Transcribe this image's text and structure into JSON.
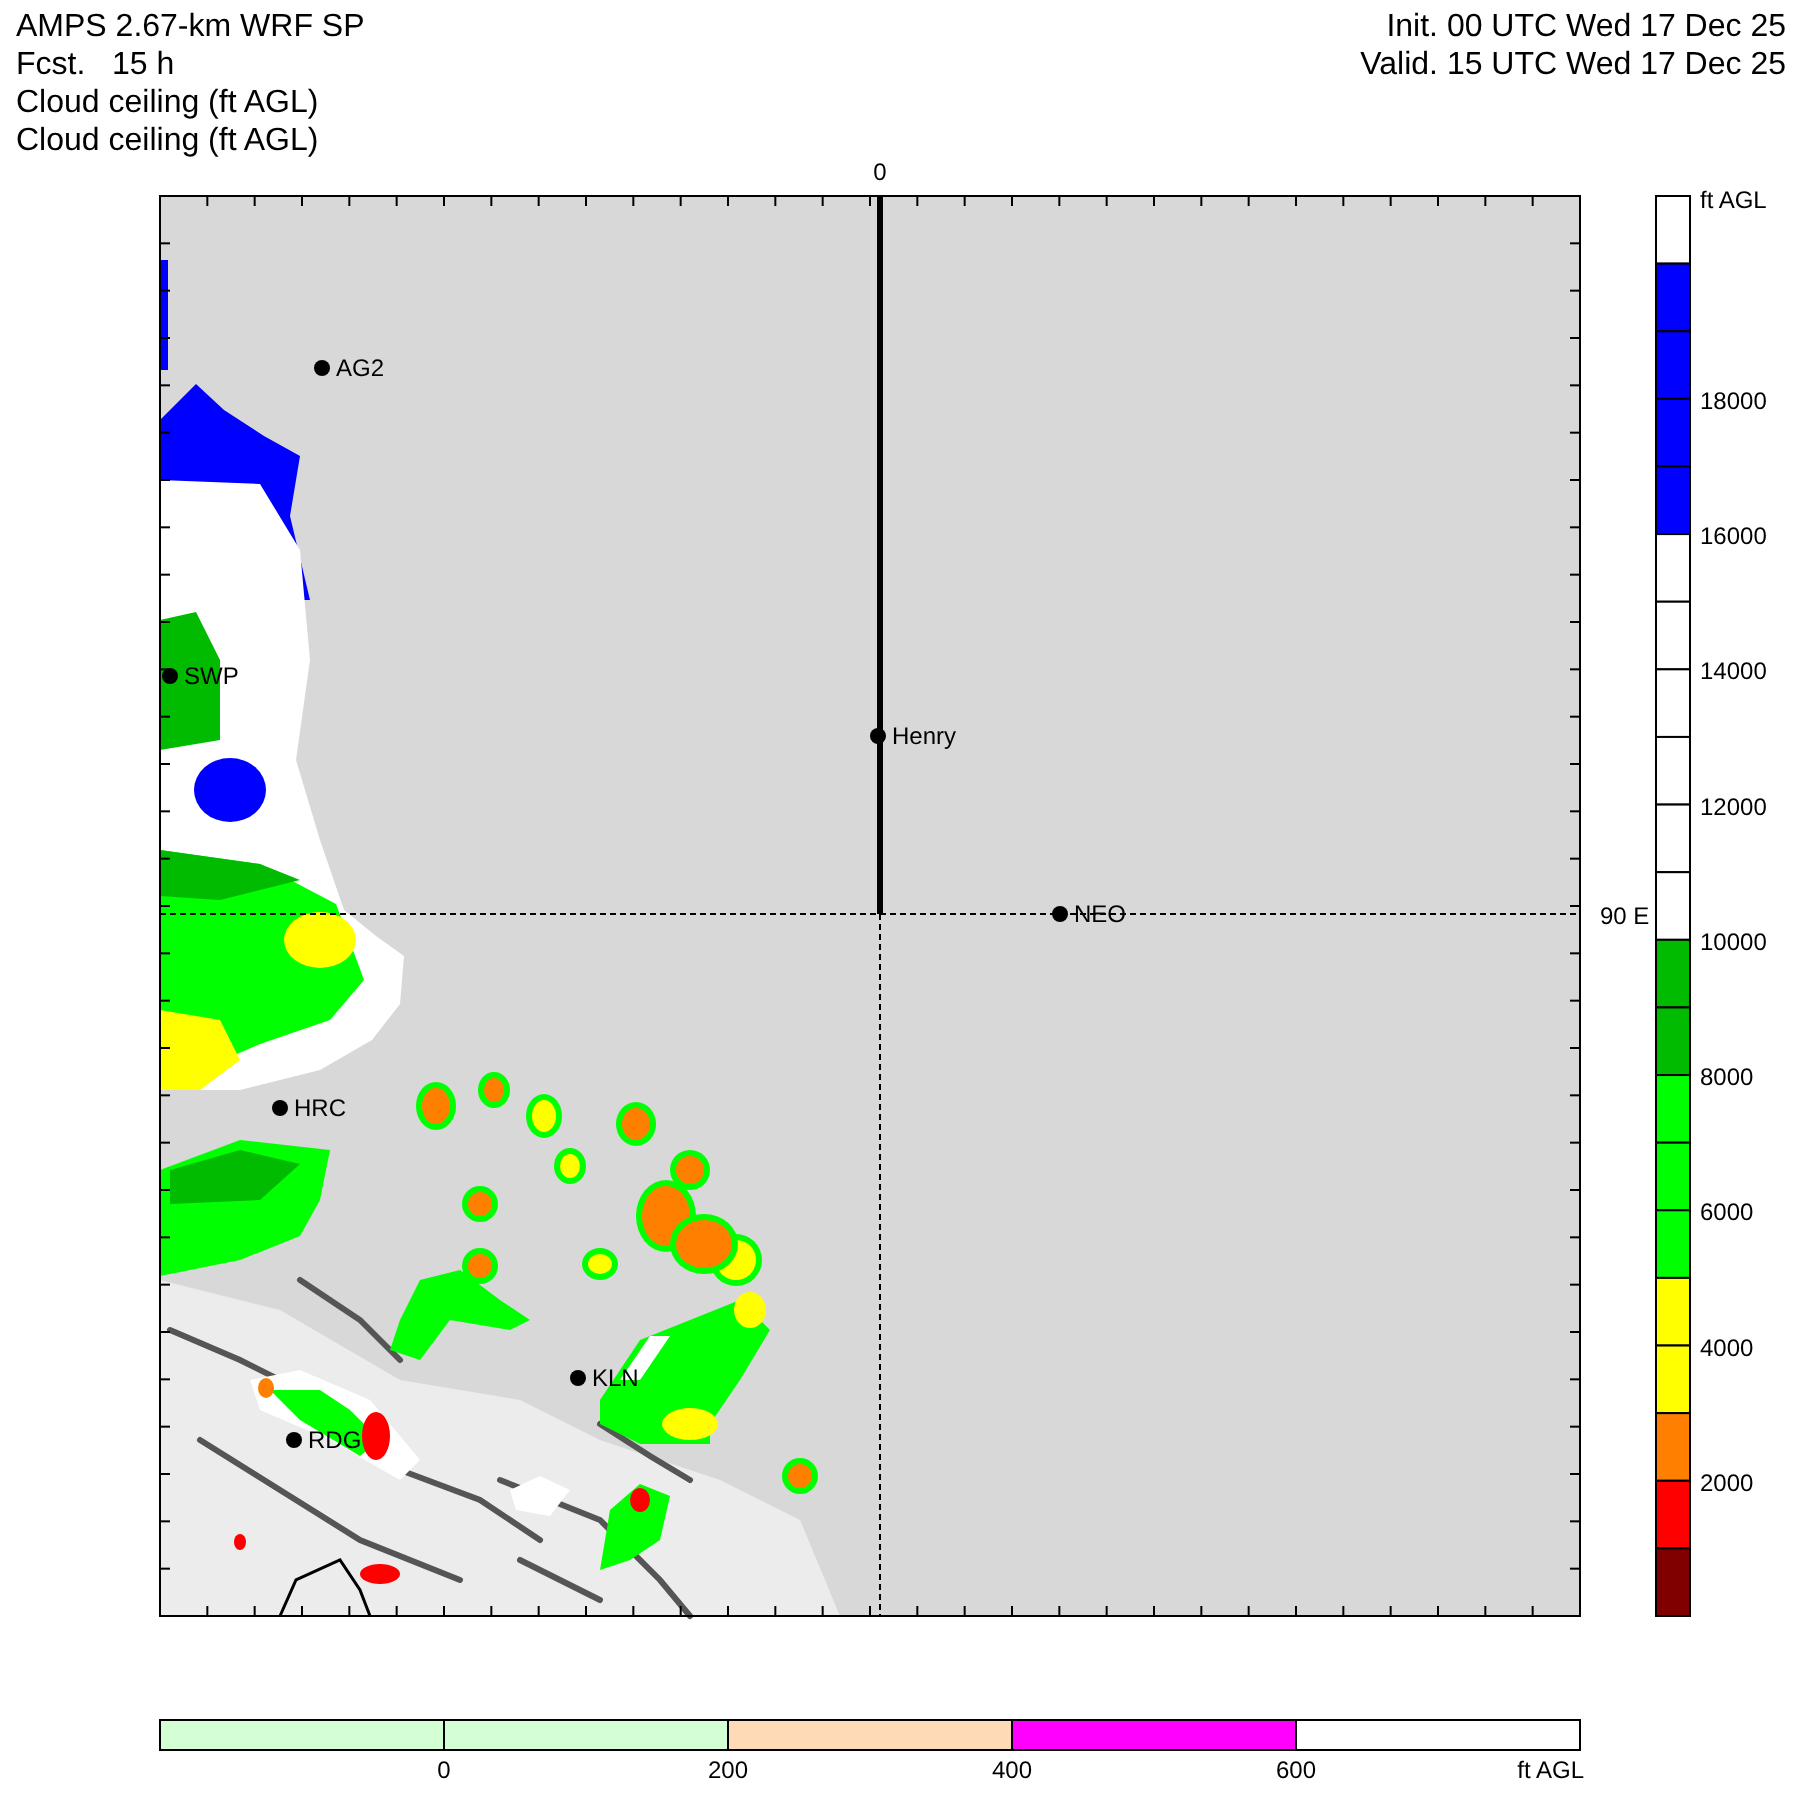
{
  "header": {
    "left": [
      "AMPS 2.67-km WRF SP",
      "Fcst.   15 h",
      "Cloud ceiling (ft AGL)",
      "Cloud ceiling (ft AGL)"
    ],
    "right": [
      "Init. 00 UTC Wed 17 Dec 25",
      "Valid. 15 UTC Wed 17 Dec 25"
    ]
  },
  "map": {
    "meridian_label": "0",
    "parallel_label": "90 E",
    "stations": [
      {
        "label": "AG2"
      },
      {
        "label": "SWP"
      },
      {
        "label": "Henry"
      },
      {
        "label": "NEO"
      },
      {
        "label": "HRC"
      },
      {
        "label": "KLN"
      },
      {
        "label": "RDG"
      }
    ]
  },
  "colorbar": {
    "units": "ft AGL",
    "segments": [
      {
        "color": "#ffffff"
      },
      {
        "color": "#0000ff"
      },
      {
        "color": "#0000ff"
      },
      {
        "color": "#0000ff"
      },
      {
        "color": "#0000ff"
      },
      {
        "color": "#ffffff"
      },
      {
        "color": "#ffffff"
      },
      {
        "color": "#ffffff"
      },
      {
        "color": "#ffffff"
      },
      {
        "color": "#ffffff"
      },
      {
        "color": "#ffffff"
      },
      {
        "color": "#00bb00"
      },
      {
        "color": "#00bb00"
      },
      {
        "color": "#00ff00"
      },
      {
        "color": "#00ff00"
      },
      {
        "color": "#00ff00"
      },
      {
        "color": "#ffff00"
      },
      {
        "color": "#ffff00"
      },
      {
        "color": "#ff8000"
      },
      {
        "color": "#ff0000"
      },
      {
        "color": "#800000"
      }
    ],
    "ticks": [
      "18000",
      "16000",
      "14000",
      "12000",
      "10000",
      "8000",
      "6000",
      "4000",
      "2000"
    ]
  },
  "terrain_legend": {
    "units": "ft AGL",
    "segments": [
      {
        "color": "#d4ffd4"
      },
      {
        "color": "#d4ffd4"
      },
      {
        "color": "#ffdab6"
      },
      {
        "color": "#ff00ff"
      },
      {
        "color": "#ffffff"
      }
    ],
    "ticks": [
      "0",
      "200",
      "400",
      "600"
    ]
  }
}
